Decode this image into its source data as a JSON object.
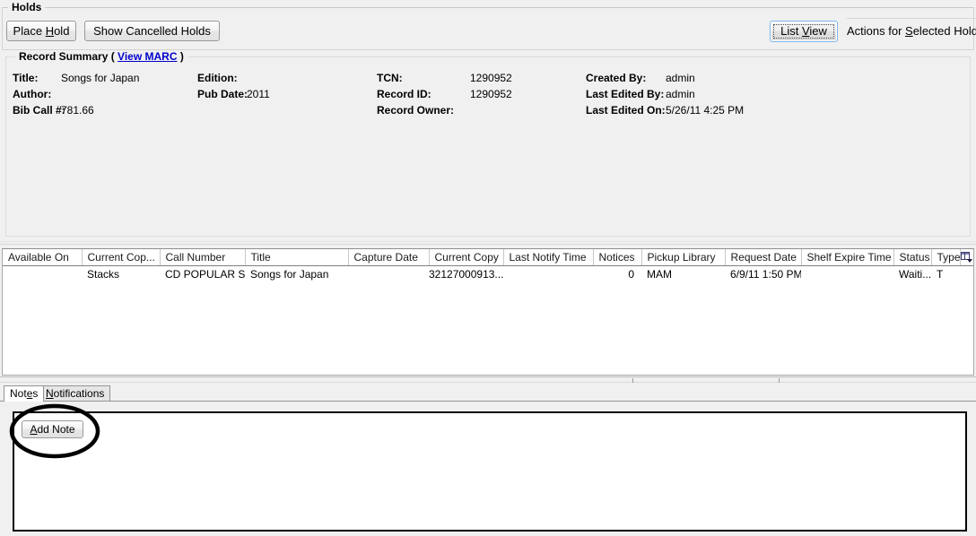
{
  "holds_group": {
    "legend": "Holds",
    "place_hold_label": "Place Hold",
    "place_hold_prefix": "Place ",
    "place_hold_accel": "H",
    "place_hold_suffix": "old",
    "show_cancelled_label": "Show Cancelled Holds",
    "list_view_prefix": "List ",
    "list_view_accel": "V",
    "list_view_suffix": "iew",
    "list_view_label": "List View",
    "actions_prefix": "Actions for ",
    "actions_accel": "S",
    "actions_suffix": "elected Holds",
    "actions_label": "Actions for Selected Holds"
  },
  "record_summary": {
    "legend_prefix": "Record Summary  ( ",
    "legend_link": "View MARC",
    "legend_suffix": " )",
    "fields": {
      "title_key": "Title:",
      "title_value": "Songs for Japan",
      "author_key": "Author:",
      "author_value": "",
      "bib_call_key": "Bib Call #:",
      "bib_call_value": "781.66",
      "edition_key": "Edition:",
      "edition_value": "",
      "pub_date_key": "Pub Date:",
      "pub_date_value": "2011",
      "tcn_key": "TCN:",
      "tcn_value": "1290952",
      "record_id_key": "Record ID:",
      "record_id_value": "1290952",
      "record_owner_key": "Record Owner:",
      "record_owner_value": "",
      "created_by_key": "Created By:",
      "created_by_value": "admin",
      "last_edited_by_key": "Last Edited By:",
      "last_edited_by_value": "admin",
      "last_edited_on_key": "Last Edited On:",
      "last_edited_on_value": "5/26/11 4:25 PM"
    }
  },
  "holds_table": {
    "columns": [
      "Available On",
      "Current Cop...",
      "Call Number",
      "Title",
      "Capture Date",
      "Current Copy",
      "Last Notify Time",
      "Notices",
      "Pickup Library",
      "Request Date",
      "Shelf Expire Time",
      "Status",
      "Type"
    ],
    "column_picker_icon": "column-picker-icon",
    "rows": [
      {
        "available_on": "",
        "current_copy_location": "Stacks",
        "call_number": "CD POPULAR S...",
        "title": "Songs for Japan",
        "capture_date": "",
        "current_copy": "32127000913...",
        "last_notify_time": "",
        "notices": "0",
        "pickup_library": "MAM",
        "request_date": "6/9/11 1:50 PM",
        "shelf_expire_time": "",
        "status": "Waiti...",
        "type": "T"
      }
    ]
  },
  "notes_section": {
    "tab_notes_prefix": "Not",
    "tab_notes_accel": "e",
    "tab_notes_suffix": "s",
    "tab_notes_label": "Notes",
    "tab_notifications_accel": "N",
    "tab_notifications_suffix": "otifications",
    "tab_notifications_label": "Notifications",
    "add_note_accel": "A",
    "add_note_suffix": "dd Note",
    "add_note_label": "Add Note",
    "notes_body": ""
  },
  "annotation": {
    "shape": "ellipse-highlight",
    "color": "#000000",
    "target": "add-note-button"
  }
}
